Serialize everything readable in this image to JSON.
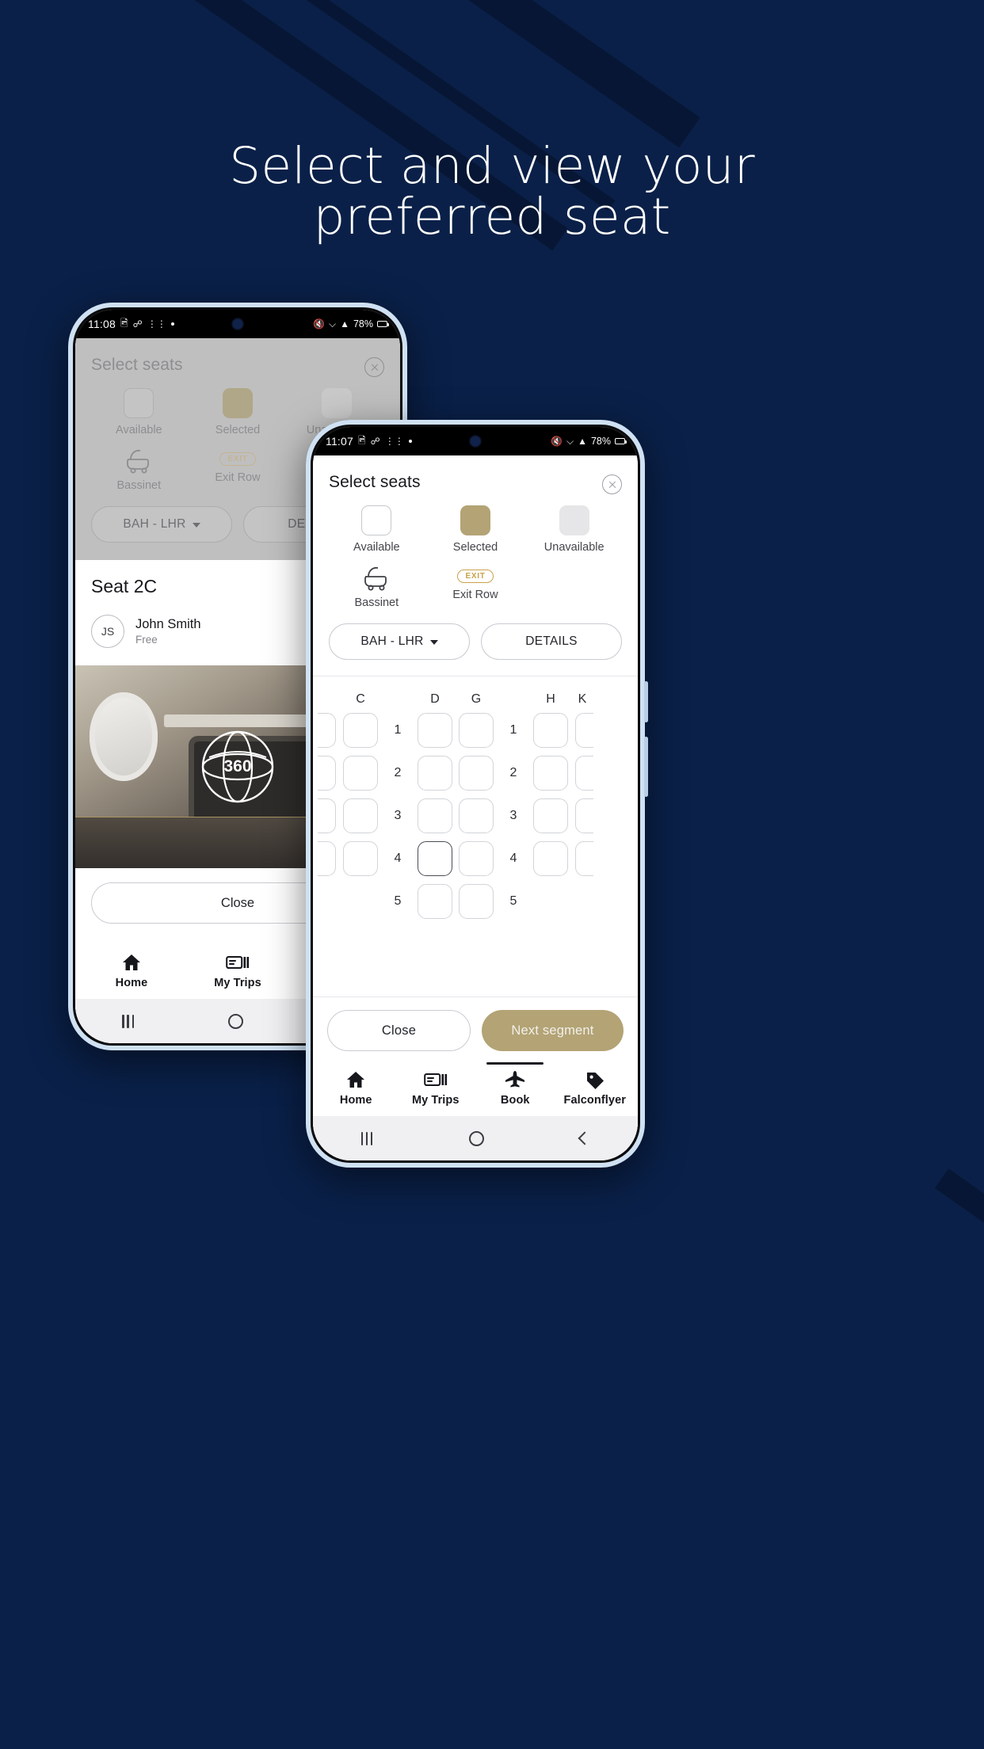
{
  "page": {
    "headline_line1": "Select and view your",
    "headline_line2": "preferred seat",
    "background_color": "#0a2048",
    "accent_gold": "#b3a375"
  },
  "phone_back": {
    "status_bar": {
      "time": "11:08",
      "left_icons": [
        "image-icon",
        "bluetooth-icon",
        "apps-icon",
        "dot-icon"
      ],
      "right_icons": [
        "mute-icon",
        "wifi-icon",
        "signal-icon"
      ],
      "battery": "78%"
    },
    "sheet": {
      "title": "Select seats",
      "close_icon": "close-circle-icon",
      "legend": [
        {
          "label": "Available",
          "swatch": "available"
        },
        {
          "label": "Selected",
          "swatch": "selected"
        },
        {
          "label": "Unavailable",
          "swatch": "unavailable"
        },
        {
          "label": "Bassinet",
          "swatch": "bassinet-icon"
        },
        {
          "label": "Exit Row",
          "swatch": "exit-badge",
          "badge": "EXIT"
        }
      ],
      "segment_label": "BAH - LHR",
      "details_label": "DETAILS"
    },
    "detail": {
      "seat_title": "Seat 2C",
      "passenger_initials": "JS",
      "passenger_name": "John Smith",
      "passenger_price": "Free",
      "photo_badge": "360",
      "close_label": "Close"
    },
    "tabs": [
      {
        "label": "Home",
        "icon": "home-icon",
        "active": false
      },
      {
        "label": "My Trips",
        "icon": "ticket-icon",
        "active": false
      },
      {
        "label": "Book",
        "icon": "plane-icon",
        "active": true
      }
    ],
    "nav": {
      "recents": "recents-icon",
      "home": "home-circle-icon",
      "back": "back-icon"
    }
  },
  "phone_front": {
    "status_bar": {
      "time": "11:07",
      "left_icons": [
        "image-icon",
        "bluetooth-icon",
        "apps-icon",
        "dot-icon"
      ],
      "right_icons": [
        "mute-icon",
        "wifi-icon",
        "signal-icon"
      ],
      "battery": "78%"
    },
    "sheet": {
      "title": "Select seats",
      "close_icon": "close-circle-icon",
      "legend": [
        {
          "label": "Available",
          "swatch": "available"
        },
        {
          "label": "Selected",
          "swatch": "selected"
        },
        {
          "label": "Unavailable",
          "swatch": "unavailable"
        },
        {
          "label": "Bassinet",
          "swatch": "bassinet-icon"
        },
        {
          "label": "Exit Row",
          "swatch": "exit-badge",
          "badge": "EXIT"
        }
      ],
      "segment_label": "BAH - LHR",
      "details_label": "DETAILS"
    },
    "seatmap": {
      "column_labels": [
        "C",
        "D",
        "G",
        "H",
        "K"
      ],
      "row_numbers_left": [
        "1",
        "2",
        "3",
        "4",
        "5"
      ],
      "row_numbers_right": [
        "1",
        "2",
        "3",
        "4",
        "5"
      ],
      "selected_seat": "4D"
    },
    "actions": {
      "close_label": "Close",
      "next_label": "Next segment"
    },
    "tabs": [
      {
        "label": "Home",
        "icon": "home-icon",
        "active": false
      },
      {
        "label": "My Trips",
        "icon": "ticket-icon",
        "active": false
      },
      {
        "label": "Book",
        "icon": "plane-icon",
        "active": true
      },
      {
        "label": "Falconflyer",
        "icon": "tag-icon",
        "active": false
      }
    ],
    "nav": {
      "recents": "recents-icon",
      "home": "home-circle-icon",
      "back": "back-icon"
    }
  }
}
